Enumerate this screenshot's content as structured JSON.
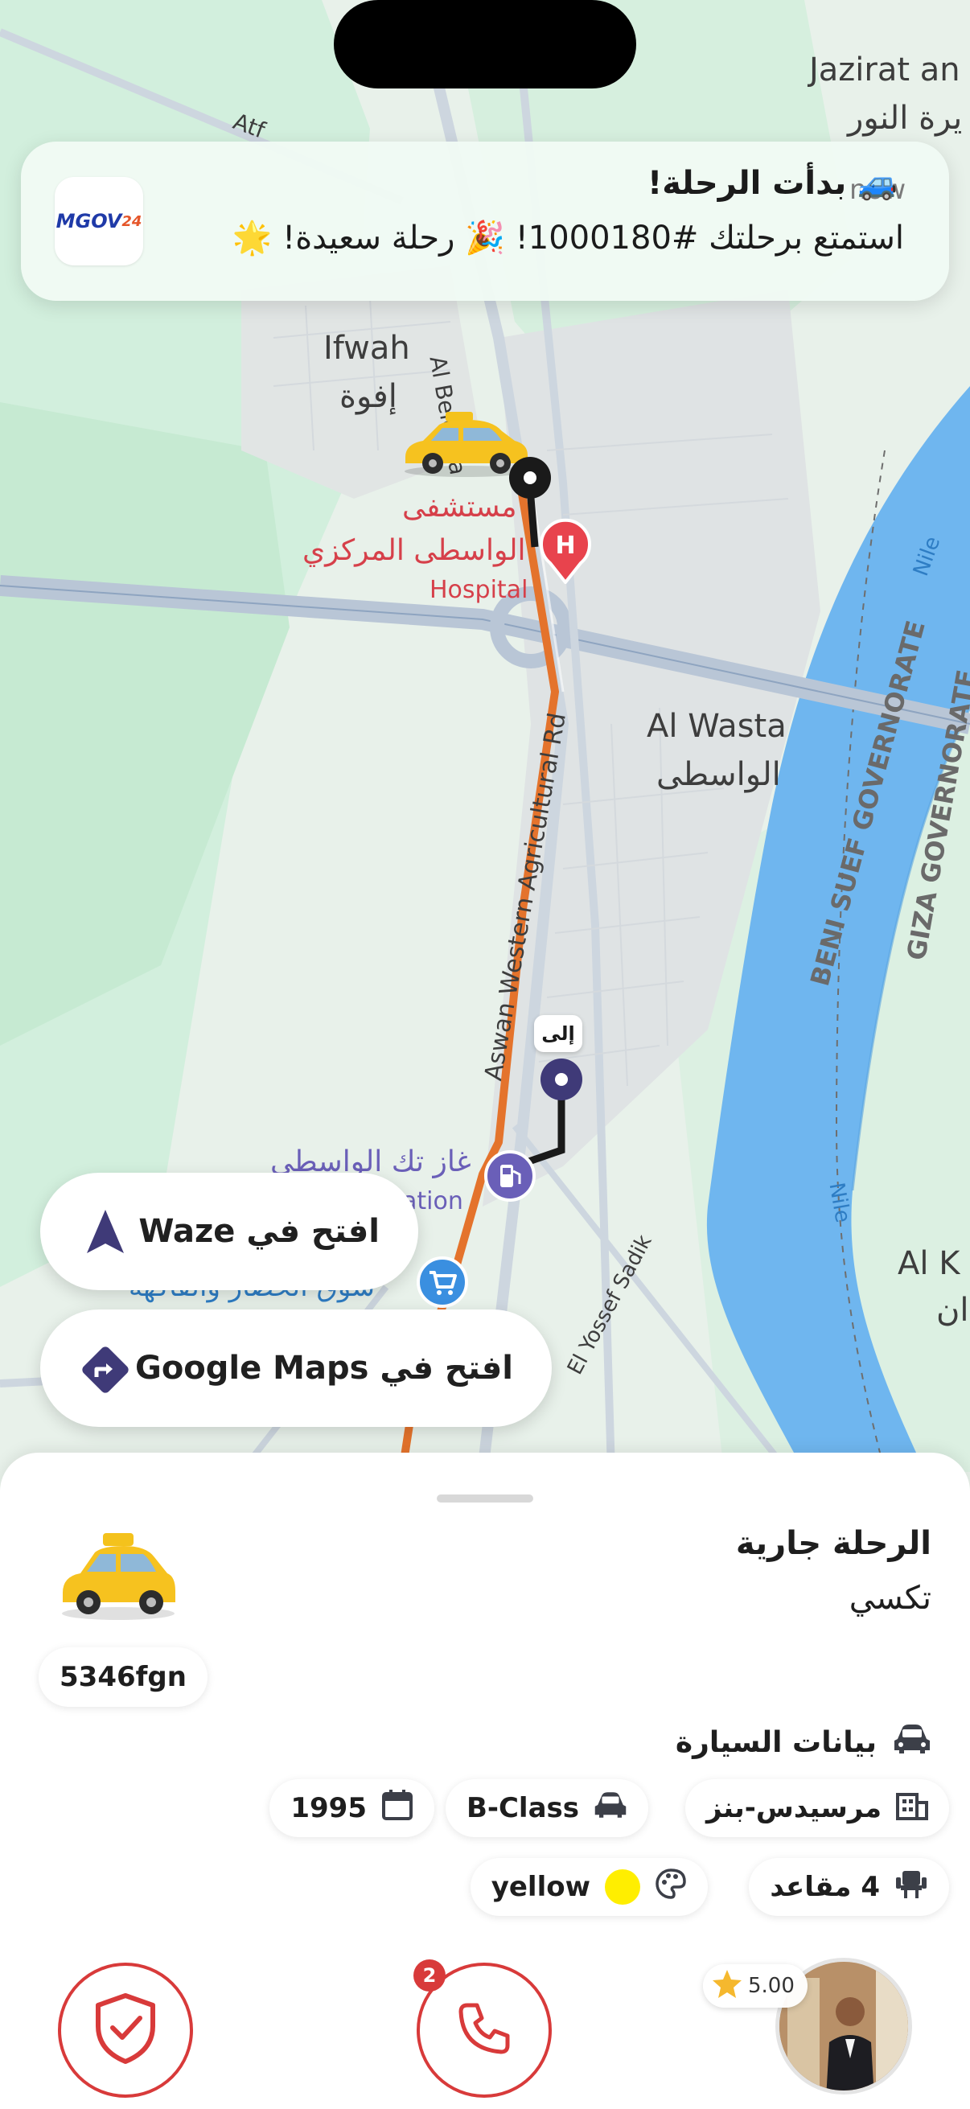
{
  "map": {
    "labels": {
      "jazirat_en": "Jazirat an",
      "jazirat_ar": "يرة النور",
      "ifwah_en": "Ifwah",
      "ifwah_ar": "إفوة",
      "hospital_ar1": "مستشفى",
      "hospital_ar2": "الواسطى المركزي",
      "hospital_en": "Hospital",
      "alwasta_en": "Al Wasta",
      "alwasta_ar": "الواسطى",
      "road_agri": "Aswan Western Agricultural Rd",
      "road_beleeda": "Al Beleeda",
      "road_atf": "Atf",
      "road_sadik": "El Yossef Sadik",
      "beni_suef": "BENI SUEF GOVERNORATE",
      "giza": "GIZA GOVERNORATE",
      "nile": "Nile",
      "gas_ar": "غاز تك الواسطى",
      "gas_en": "ation",
      "market_ar": "سوق الخضار والفاكهة",
      "al_k": "Al K",
      "al_k_ar": "ان",
      "destination_tag": "إلى"
    },
    "colors": {
      "land": "#e8f1ea",
      "green": "#c9ead3",
      "water": "#6fb6ef",
      "route": "#e4732c",
      "route_black": "#1a1a1a",
      "hospital": "#e8434d",
      "poi_blue": "#3a8fe0",
      "poi_purple": "#6a5fb8"
    }
  },
  "notification": {
    "app_icon_text_main": "MGOV",
    "app_icon_text_suffix": "24",
    "title": "🚙 بدأت الرحلة!",
    "body": "استمتع برحلتك #1000180! 🎉 رحلة سعيدة! 🌟",
    "time": "now"
  },
  "nav_buttons": {
    "waze_label": "افتح في Waze",
    "waze_icon": "navigation-arrow-icon",
    "google_label": "افتح في Google Maps",
    "google_icon": "directions-icon"
  },
  "sheet": {
    "trip_status": "الرحلة جارية",
    "service_type": "تكسي",
    "plate_number": "5346fgn",
    "car_section_title": "بيانات السيارة",
    "car": {
      "make": "مرسيدس-بنز",
      "model": "B-Class",
      "year": "1995",
      "seats": "4 مقاعد",
      "color_name": "yellow",
      "color_hex": "#ffee00"
    },
    "driver": {
      "rating": "5.00"
    },
    "call_badge": "2",
    "colors": {
      "accent_red": "#d83a3a"
    }
  }
}
